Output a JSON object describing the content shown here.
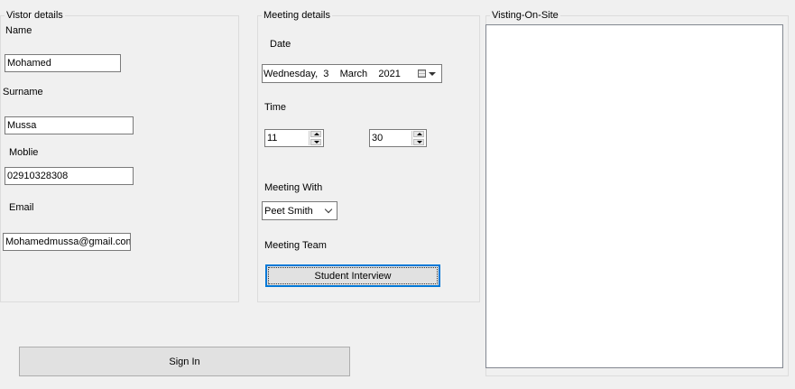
{
  "visitor_details": {
    "title": "Vistor details",
    "name_label": "Name",
    "name_value": "Mohamed",
    "surname_label": "Surname",
    "surname_value": "Mussa",
    "mobile_label": "Moblie",
    "mobile_value": "02910328308",
    "email_label": "Email",
    "email_value": "Mohamedmussa@gmail.com"
  },
  "meeting_details": {
    "title": "Meeting details",
    "date_label": "Date",
    "date_value": "Wednesday,  3    March    2021",
    "time_label": "Time",
    "hour_value": "11",
    "minute_value": "30",
    "meeting_with_label": "Meeting With",
    "meeting_with_value": "Peet Smith",
    "meeting_team_label": "Meeting Team",
    "meeting_team_button": "Student Interview"
  },
  "on_site": {
    "title": "Visting-On-Site"
  },
  "sign_in_button": "Sign In",
  "icons": {
    "calendar": "calendar-icon",
    "dropdown": "chevron-down-icon",
    "spin_up": "arrow-up-icon",
    "spin_down": "arrow-down-icon"
  },
  "colors": {
    "window_bg": "#f0f0f0",
    "focus_border": "#0078d7",
    "button_bg": "#e1e1e1"
  }
}
